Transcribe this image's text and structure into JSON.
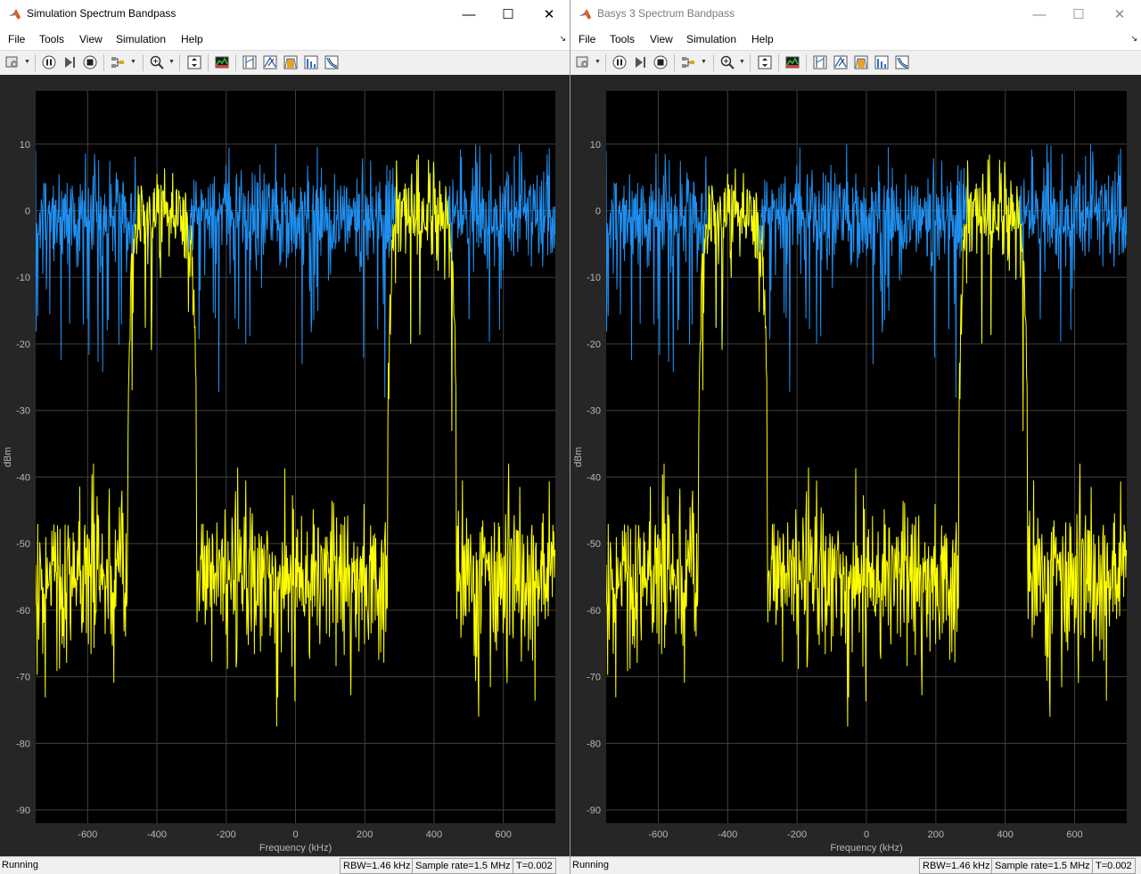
{
  "windows": [
    {
      "title": "Simulation Spectrum Bandpass",
      "menu": [
        "File",
        "Tools",
        "View",
        "Simulation",
        "Help"
      ],
      "controls": {
        "minimize": "—",
        "maximize": "☐",
        "close": "✕"
      },
      "status": {
        "state": "Running",
        "rbw": "RBW=1.46 kHz",
        "sample_rate": "Sample rate=1.5 MHz",
        "time": "T=0.002"
      }
    },
    {
      "title": "Basys 3 Spectrum Bandpass",
      "menu": [
        "File",
        "Tools",
        "View",
        "Simulation",
        "Help"
      ],
      "controls": {
        "minimize": "—",
        "maximize": "☐",
        "close": "✕"
      },
      "status": {
        "state": "Running",
        "rbw": "RBW=1.46 kHz",
        "sample_rate": "Sample rate=1.5 MHz",
        "time": "T=0.002"
      }
    }
  ],
  "toolbar_icons": [
    "settings-icon",
    "pause-icon",
    "step-forward-icon",
    "stop-icon",
    "highlight-signal-icon",
    "zoom-icon",
    "scale-axes-icon",
    "spectrum-view-icon",
    "cursor-measurements-icon",
    "peak-finder-icon",
    "channel-measurements-icon",
    "distortion-measurements-icon",
    "ccdf-icon"
  ],
  "colors": {
    "background": "#000000",
    "grid": "#404040",
    "axes_text": "#b8b8b8",
    "input_series": "#1f8ff0",
    "output_series": "#ffff00"
  },
  "chart_data": [
    {
      "type": "line",
      "xlabel": "Frequency (kHz)",
      "ylabel": "dBm",
      "xlim": [
        -750,
        750
      ],
      "ylim": [
        -92,
        18
      ],
      "xticks": [
        -600,
        -400,
        -200,
        0,
        200,
        400,
        600
      ],
      "yticks": [
        10,
        0,
        -10,
        -20,
        -30,
        -40,
        -50,
        -60,
        -70,
        -80,
        -90
      ],
      "grid": true,
      "series": [
        {
          "color": "#1f8ff0",
          "description": "noise input spectrum",
          "mean_dBm": -1,
          "spread_dBm": [
            -30,
            10
          ]
        },
        {
          "color": "#ffff00",
          "description": "bandpass output spectrum",
          "passbands_kHz": [
            [
              -480,
              -290
            ],
            [
              270,
              460
            ]
          ],
          "passband_level_dBm": -3,
          "stopband_level_dBm": -55,
          "stopband_min_dBm": -83
        }
      ]
    },
    {
      "type": "line",
      "xlabel": "Frequency (kHz)",
      "ylabel": "dBm",
      "xlim": [
        -750,
        750
      ],
      "ylim": [
        -92,
        18
      ],
      "xticks": [
        -600,
        -400,
        -200,
        0,
        200,
        400,
        600
      ],
      "yticks": [
        10,
        0,
        -10,
        -20,
        -30,
        -40,
        -50,
        -60,
        -70,
        -80,
        -90
      ],
      "grid": true,
      "series": [
        {
          "color": "#1f8ff0",
          "description": "noise input spectrum",
          "mean_dBm": -1,
          "spread_dBm": [
            -30,
            10
          ]
        },
        {
          "color": "#ffff00",
          "description": "bandpass output spectrum",
          "passbands_kHz": [
            [
              -480,
              -290
            ],
            [
              270,
              460
            ]
          ],
          "passband_level_dBm": -3,
          "stopband_level_dBm": -55,
          "stopband_min_dBm": -83
        }
      ]
    }
  ]
}
